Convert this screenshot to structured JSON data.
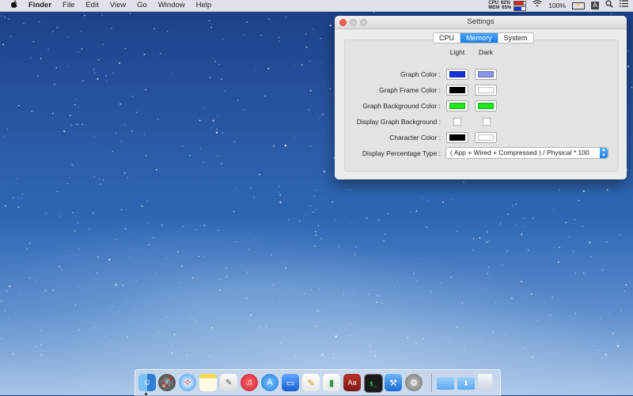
{
  "menubar": {
    "apple": "",
    "app_name": "Finder",
    "items": [
      "File",
      "Edit",
      "View",
      "Go",
      "Window",
      "Help"
    ],
    "cpu_label": "CPU",
    "cpu_value": "82%",
    "mem_label": "MEM",
    "mem_value": "65%",
    "cpu_fraction": 0.82,
    "mem_fraction": 0.65,
    "battery_text": "100%",
    "input_source": "A",
    "status_icons": [
      "wifi-icon",
      "battery-icon",
      "spotlight-icon",
      "notification-center-icon"
    ]
  },
  "settings_window": {
    "title": "Settings",
    "tabs": [
      {
        "label": "CPU",
        "active": false
      },
      {
        "label": "Memory",
        "active": true
      },
      {
        "label": "System",
        "active": false
      }
    ],
    "columns": [
      "Light",
      "Dark"
    ],
    "rows": [
      {
        "label": "Graph Color :",
        "type": "color",
        "light": "#1432d8",
        "dark": "#8c94e8"
      },
      {
        "label": "Graph Frame Color :",
        "type": "color",
        "light": "#000000",
        "dark": "#ffffff"
      },
      {
        "label": "Graph Background Color :",
        "type": "color",
        "light": "#1ee61e",
        "dark": "#1ee61e"
      },
      {
        "label": "Display Graph Background :",
        "type": "checkbox",
        "light": false,
        "dark": false
      },
      {
        "label": "Character Color :",
        "type": "color",
        "light": "#000000",
        "dark": "#ffffff"
      }
    ],
    "percentage_type": {
      "label": "Display Percentage Type :",
      "value": "( App + Wired + Compressed ) / Physical * 100"
    }
  },
  "dock": {
    "apps": [
      "finder-icon",
      "launchpad-icon",
      "safari-icon",
      "notes-icon",
      "textedit-icon",
      "itunes-icon",
      "app-store-icon",
      "keynote-icon",
      "pages-icon",
      "numbers-icon",
      "dictionary-icon",
      "terminal-icon",
      "xcode-icon",
      "system-preferences-icon"
    ],
    "folders": [
      "documents-folder-icon",
      "downloads-folder-icon",
      "trash-icon"
    ]
  }
}
